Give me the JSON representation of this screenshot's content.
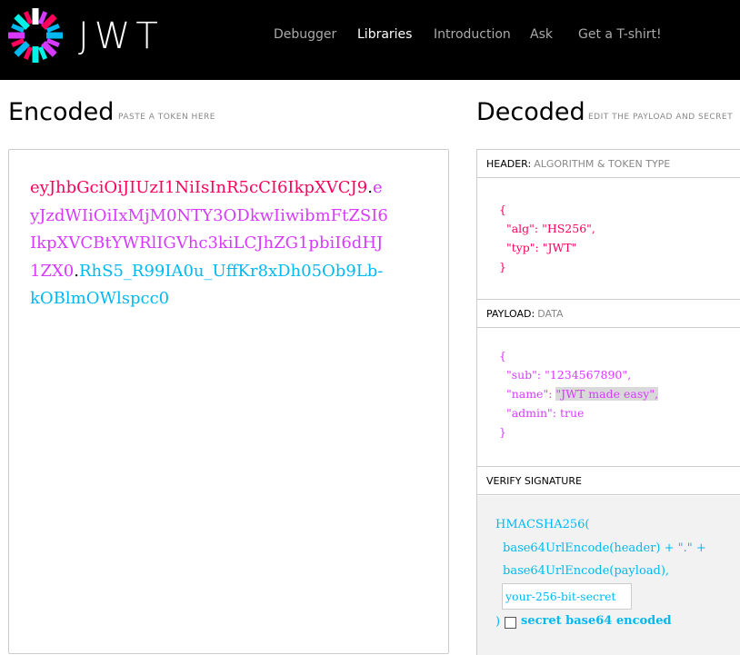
{
  "brand": {
    "logo_text": "JWT"
  },
  "nav": [
    {
      "label": "Debugger",
      "active": false
    },
    {
      "label": "Libraries",
      "active": true
    },
    {
      "label": "Introduction",
      "active": false
    },
    {
      "label": "Ask",
      "active": false
    },
    {
      "label": "Get a T-shirt!",
      "active": false
    }
  ],
  "encoded": {
    "title": "Encoded",
    "subtitle": "PASTE A TOKEN HERE",
    "token_header": "eyJhbGciOiJIUzI1NiIsInR5cCI6IkpXVCJ9",
    "token_payload": "eyJzdWIiOiIxMjM0NTY3ODkwIiwibmFtZSI6IkpXVCBtYWRlIGVhc3kiLCJhZG1pbiI6dHJ1ZX0",
    "token_signature": "RhS5_R99IA0u_UffKr8xDh05Ob9Lb-kOBlmOWlspcc0",
    "dot": "."
  },
  "decoded": {
    "title": "Decoded",
    "subtitle": "EDIT THE PAYLOAD AND SECRET",
    "header_section": {
      "label": "HEADER:",
      "sublabel": "ALGORITHM & TOKEN TYPE"
    },
    "header_json": {
      "open": "{",
      "line1": "  \"alg\": \"HS256\",",
      "line2": "  \"typ\": \"JWT\"",
      "close": "}"
    },
    "payload_section": {
      "label": "PAYLOAD:",
      "sublabel": "DATA"
    },
    "payload_json": {
      "open": "{",
      "line1": "  \"sub\": \"1234567890\",",
      "line2_key": "  \"name\": ",
      "line2_value": "\"JWT made easy\",",
      "line3": "  \"admin\": true",
      "close": "}"
    },
    "verify_section": {
      "label": "VERIFY SIGNATURE"
    },
    "verify": {
      "fn": "HMACSHA256(",
      "arg1": "base64UrlEncode(header) + \".\" +",
      "arg2": "base64UrlEncode(payload),",
      "secret_value": "your-256-bit-secret",
      "close": ")",
      "checkbox_label": "secret base64 encoded",
      "checkbox_checked": false
    }
  },
  "colors": {
    "header": "#fb015b",
    "payload": "#d63aff",
    "signature": "#00b9f1"
  }
}
